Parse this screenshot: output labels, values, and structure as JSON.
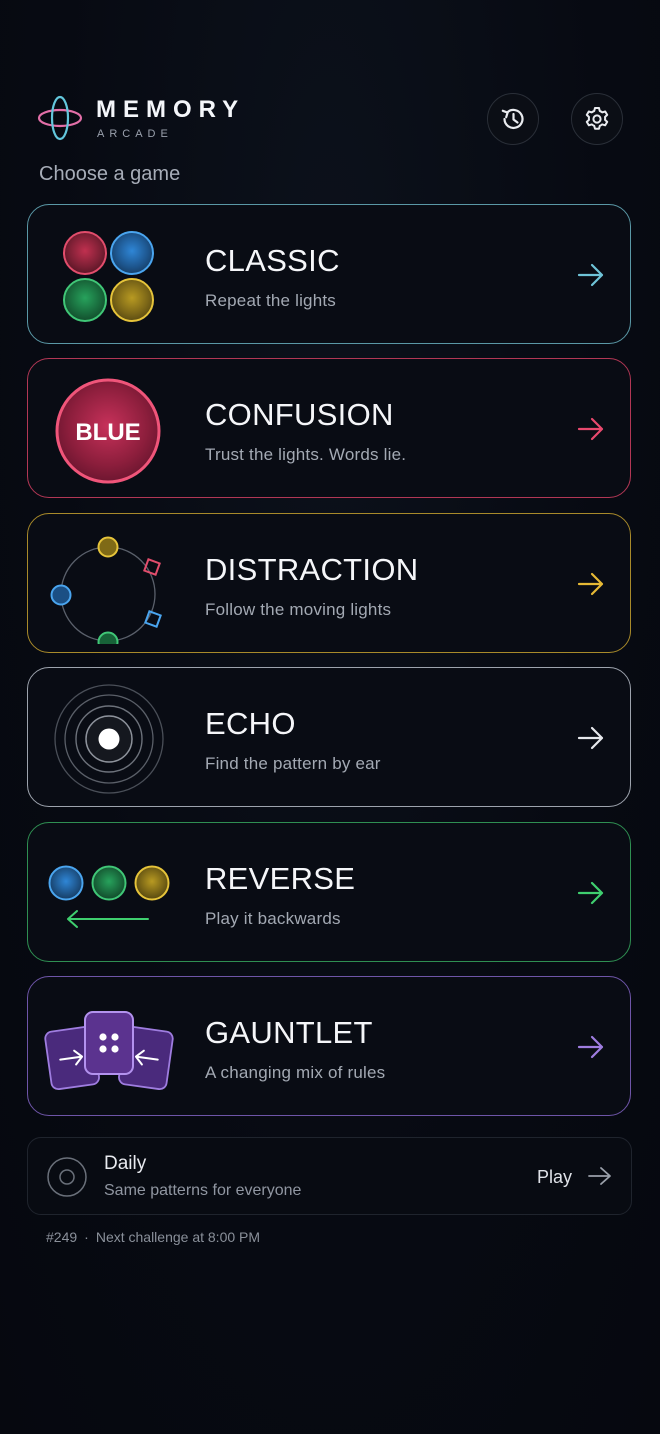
{
  "app": {
    "title": "MEMORY",
    "subtitle": "ARCADE"
  },
  "header": {
    "history_icon": "history-icon",
    "settings_icon": "gear-icon"
  },
  "section_label": "Choose a game",
  "games": [
    {
      "id": "classic",
      "title": "CLASSIC",
      "desc": "Repeat the lights",
      "accent": "#6fc4d8"
    },
    {
      "id": "confusion",
      "title": "CONFUSION",
      "desc": "Trust the lights. Words lie.",
      "accent": "#e8496e",
      "art_word": "BLUE"
    },
    {
      "id": "distraction",
      "title": "DISTRACTION",
      "desc": "Follow the moving lights",
      "accent": "#e6b935"
    },
    {
      "id": "echo",
      "title": "ECHO",
      "desc": "Find the pattern by ear",
      "accent": "#e6e8ec"
    },
    {
      "id": "reverse",
      "title": "REVERSE",
      "desc": "Play it backwards",
      "accent": "#3fcf6f"
    },
    {
      "id": "gauntlet",
      "title": "GAUNTLET",
      "desc": "A changing mix of rules",
      "accent": "#9f7de0"
    }
  ],
  "daily": {
    "title": "Daily",
    "subtitle": "Same patterns for everyone",
    "play_label": "Play"
  },
  "footer": {
    "number": "#249",
    "separator": "·",
    "next_challenge": "Next challenge at 8:00 PM"
  },
  "colors": {
    "red": "#d8334f",
    "blue": "#2f8fe0",
    "green": "#2fb063",
    "yellow": "#d9b52b",
    "purple": "#7b4fc4"
  }
}
